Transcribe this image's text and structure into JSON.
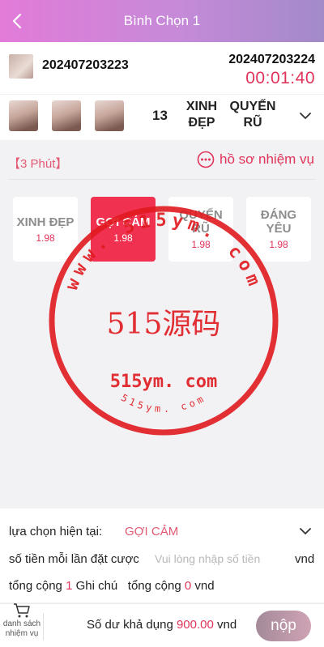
{
  "header": {
    "title": "Bình Chọn 1"
  },
  "period": {
    "previous": "202407203223",
    "current": "202407203224",
    "countdown": "00:01:40"
  },
  "result": {
    "number": "13",
    "words": [
      [
        "XINH",
        "ĐẸP"
      ],
      [
        "QUYẾN",
        "RŨ"
      ]
    ]
  },
  "game": {
    "timer_label": "【3 Phút】",
    "mission_link": "hồ sơ nhiệm vụ"
  },
  "options": [
    {
      "name": [
        "XINH ĐẸP"
      ],
      "odds": "1.98",
      "selected": false
    },
    {
      "name": [
        "GỢI CẢM"
      ],
      "odds": "1.98",
      "selected": true
    },
    {
      "name": [
        "QUYẾN",
        "RŨ"
      ],
      "odds": "1.98",
      "selected": false
    },
    {
      "name": [
        "ĐÁNG",
        "YÊU"
      ],
      "odds": "1.98",
      "selected": false
    }
  ],
  "watermark": {
    "center_text": "515源码",
    "lower_text": "515ym. com",
    "arc_top": "www. 515ym. com",
    "arc_bottom": "515ym. com",
    "color": "#e0191f"
  },
  "bet": {
    "selection_label": "lựa chọn hiện tại:",
    "selection_value": "GỢI CẢM",
    "amount_label": "số tiền mỗi lần đặt cược",
    "amount_placeholder": "Vui lòng nhập số tiền",
    "amount_value": "",
    "unit": "vnd",
    "total_prefix": "tổng cộng",
    "total_count": "1",
    "total_note": "Ghi chú",
    "total_amount_prefix": "tổng cộng",
    "total_amount": "0",
    "total_unit": "vnd"
  },
  "footer": {
    "cart_label": "danh sách nhiệm vụ",
    "balance_label": "Số dư khả dụng",
    "balance_value": "900.00",
    "balance_unit": "vnd",
    "submit_label": "nộp"
  },
  "colors": {
    "accent": "#e0345a",
    "selected_option": "#f0314f",
    "header_start": "#e27bd9",
    "header_end": "#a28ac9"
  }
}
